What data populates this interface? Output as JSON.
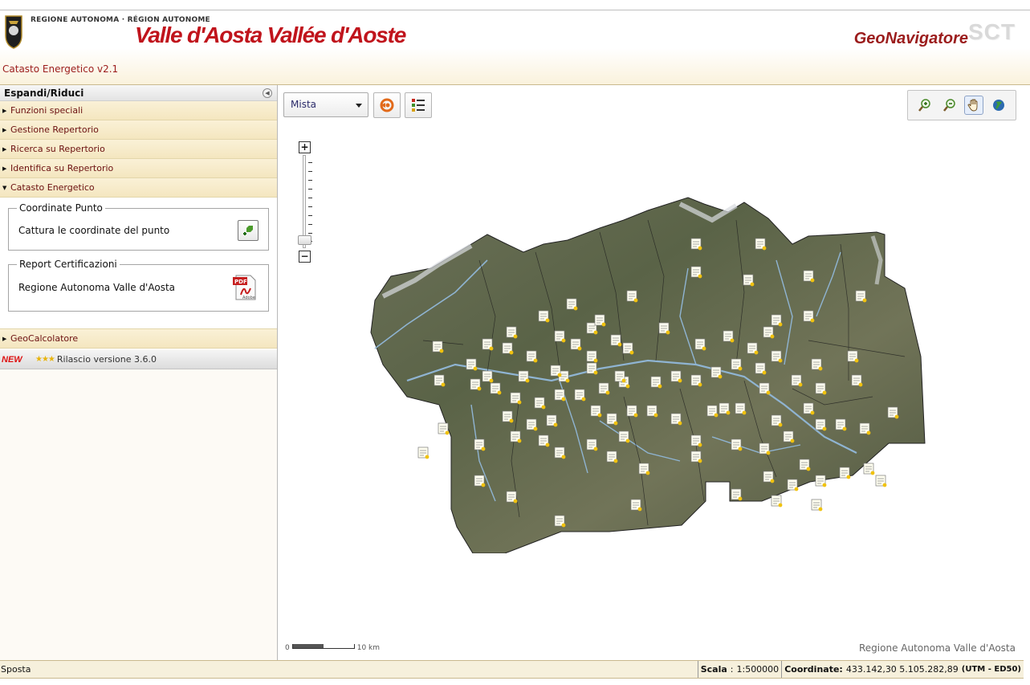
{
  "header": {
    "region_small": "REGIONE AUTONOMA · RÉGION AUTONOME",
    "region_big": "Valle d'Aosta Vallée d'Aoste",
    "product": "GeoNavigatore",
    "product_badge": "SCT",
    "app_title": "Catasto Energetico v2.1"
  },
  "sidebar": {
    "title": "Espandi/Riduci",
    "items": [
      {
        "label": "Funzioni speciali"
      },
      {
        "label": "Gestione Repertorio"
      },
      {
        "label": "Ricerca su Repertorio"
      },
      {
        "label": "Identifica su Repertorio"
      },
      {
        "label": "Catasto Energetico"
      }
    ],
    "panel": {
      "coord_legend": "Coordinate Punto",
      "coord_text": "Cattura le coordinate del punto",
      "report_legend": "Report Certificazioni",
      "report_text": "Regione Autonoma Valle d'Aosta",
      "pdf_label": "PDF",
      "adobe_label": "Adobe"
    },
    "after_items": [
      {
        "label": "GeoCalcolatore"
      }
    ],
    "news": {
      "badge": "NEW",
      "stars": "★★★",
      "text": "Rilascio versione 3.6.0"
    }
  },
  "map": {
    "basemap": "Mista",
    "scale_start": "0",
    "scale_end": "10 km",
    "attribution": "Regione Autonoma Valle d'Aosta",
    "toolbar_icons": [
      "refresh-icon",
      "legend-list-icon"
    ],
    "nav_icons": [
      "zoom-in-icon",
      "zoom-out-icon",
      "pan-hand-icon",
      "globe-icon"
    ],
    "accent": "#9b1c1c"
  },
  "status": {
    "mode": "Sposta",
    "scale_label": "Scala",
    "scale_value": "1:500000",
    "coord_label": "Coordinate:",
    "coord_value": "433.142,30 5.105.282,89",
    "coord_ref": "(UTM - ED50)"
  }
}
